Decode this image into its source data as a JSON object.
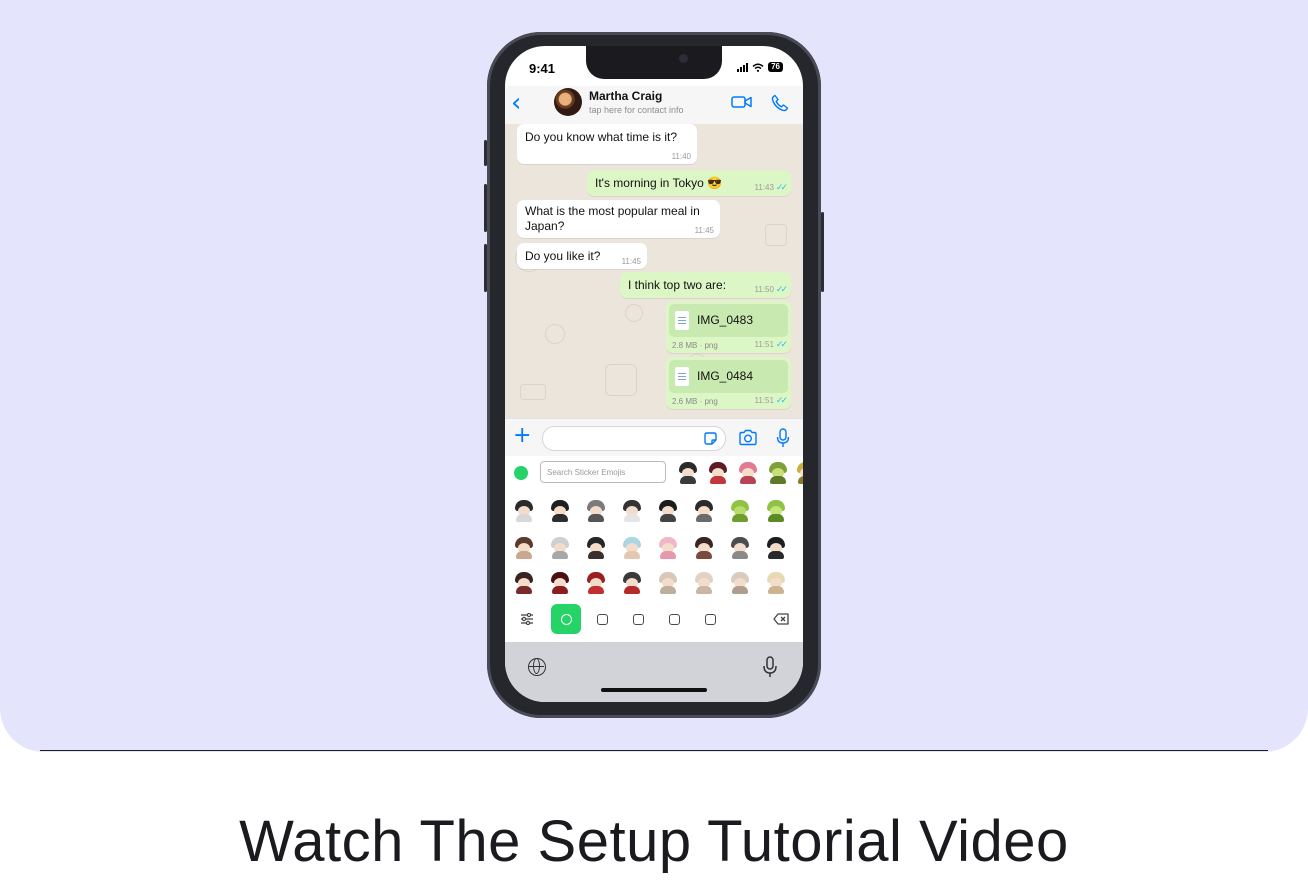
{
  "caption": "Watch The Setup Tutorial Video",
  "status_bar": {
    "time": "9:41",
    "battery": "76"
  },
  "chat_header": {
    "back": "‹",
    "contact_name": "Martha Craig",
    "contact_subtitle": "tap here for contact info"
  },
  "messages": [
    {
      "direction": "in",
      "text": "Do you know what time is it?",
      "time": "11:40"
    },
    {
      "direction": "out",
      "text": "It's morning in Tokyo 😎",
      "time": "11:43"
    },
    {
      "direction": "in",
      "text": "What is the most popular meal in\nJapan?",
      "time": "11:45"
    },
    {
      "direction": "in",
      "text": "Do you like it?",
      "time": "11:45"
    },
    {
      "direction": "out",
      "text": "I think top two are:",
      "time": "11:50"
    }
  ],
  "files": [
    {
      "name": "IMG_0483",
      "size": "2.8 MB · png",
      "time": "11:51"
    },
    {
      "name": "IMG_0484",
      "size": "2.6 MB · png",
      "time": "11:51"
    }
  ],
  "input_bar": {
    "plus": "+"
  },
  "sticker_search": {
    "placeholder": "Search Sticker Emojis"
  },
  "colors": {
    "hero_background": "#e4e5fd",
    "accent_blue": "#007aff",
    "whatsapp_green": "#25d366",
    "outgoing_bubble": "#dcf7c5",
    "chat_background": "#ece5dc"
  }
}
